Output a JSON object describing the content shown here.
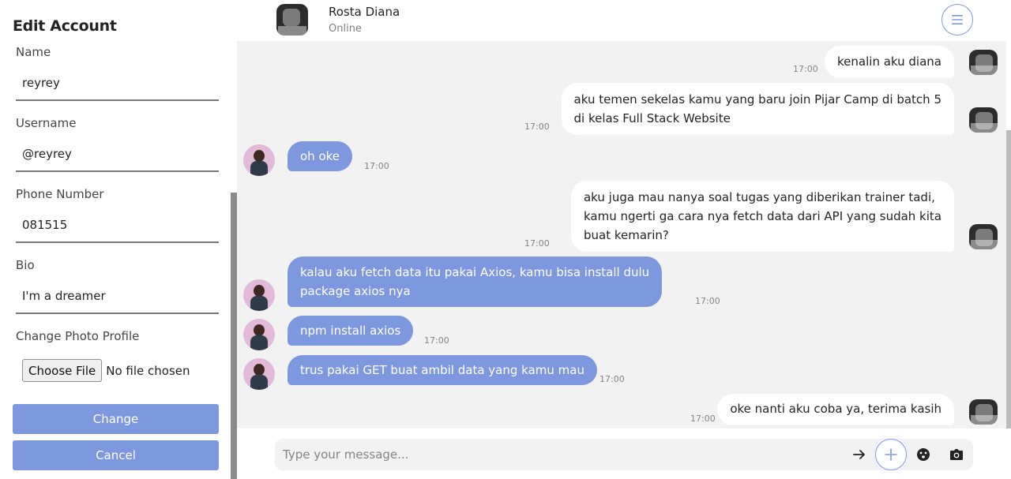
{
  "edit_account": {
    "title": "Edit Account",
    "name_label": "Name",
    "name_value": "reyrey",
    "username_label": "Username",
    "username_value": "@reyrey",
    "phone_label": "Phone Number",
    "phone_value": "081515",
    "bio_label": "Bio",
    "bio_value": "I'm a dreamer",
    "photo_label": "Change Photo Profile",
    "choose_file_label": "Choose File",
    "file_status": "No file chosen",
    "change_button": "Change",
    "cancel_button": "Cancel"
  },
  "chat_header": {
    "contact_name": "Rosta Diana",
    "status": "Online",
    "menu_icon": "hamburger-menu-icon"
  },
  "messages": [
    {
      "from": "me",
      "lines": [
        "kenalin aku diana"
      ],
      "time": "17:00"
    },
    {
      "from": "me",
      "lines": [
        "aku temen sekelas kamu yang baru join Pijar Camp di batch 5",
        "di kelas Full Stack Website"
      ],
      "time": "17:00"
    },
    {
      "from": "them",
      "lines": [
        "oh oke"
      ],
      "time": "17:00"
    },
    {
      "from": "me",
      "lines": [
        "aku juga mau nanya soal tugas yang diberikan trainer tadi,",
        "kamu ngerti ga cara nya fetch data dari API yang sudah kita",
        "buat kemarin?"
      ],
      "time": "17:00"
    },
    {
      "from": "them",
      "lines": [
        "kalau aku fetch data itu pakai Axios, kamu bisa install dulu",
        "package axios nya"
      ],
      "time": "17:00"
    },
    {
      "from": "them",
      "lines": [
        "npm install axios"
      ],
      "time": "17:00"
    },
    {
      "from": "them",
      "lines": [
        "trus pakai GET buat ambil data yang kamu mau"
      ],
      "time": "17:00"
    },
    {
      "from": "me",
      "lines": [
        "oke nanti aku coba ya, terima kasih"
      ],
      "time": "17:00"
    }
  ],
  "composer": {
    "placeholder": "Type your message...",
    "send_icon": "arrow-right-icon",
    "add_icon": "plus-icon",
    "emoji_icon": "emoji-icon",
    "camera_icon": "camera-icon"
  },
  "colors": {
    "accent": "#7e98df",
    "chat_background": "#f2f2f2",
    "outgoing_bubble": "#ffffff",
    "incoming_bubble": "#7e98df"
  }
}
